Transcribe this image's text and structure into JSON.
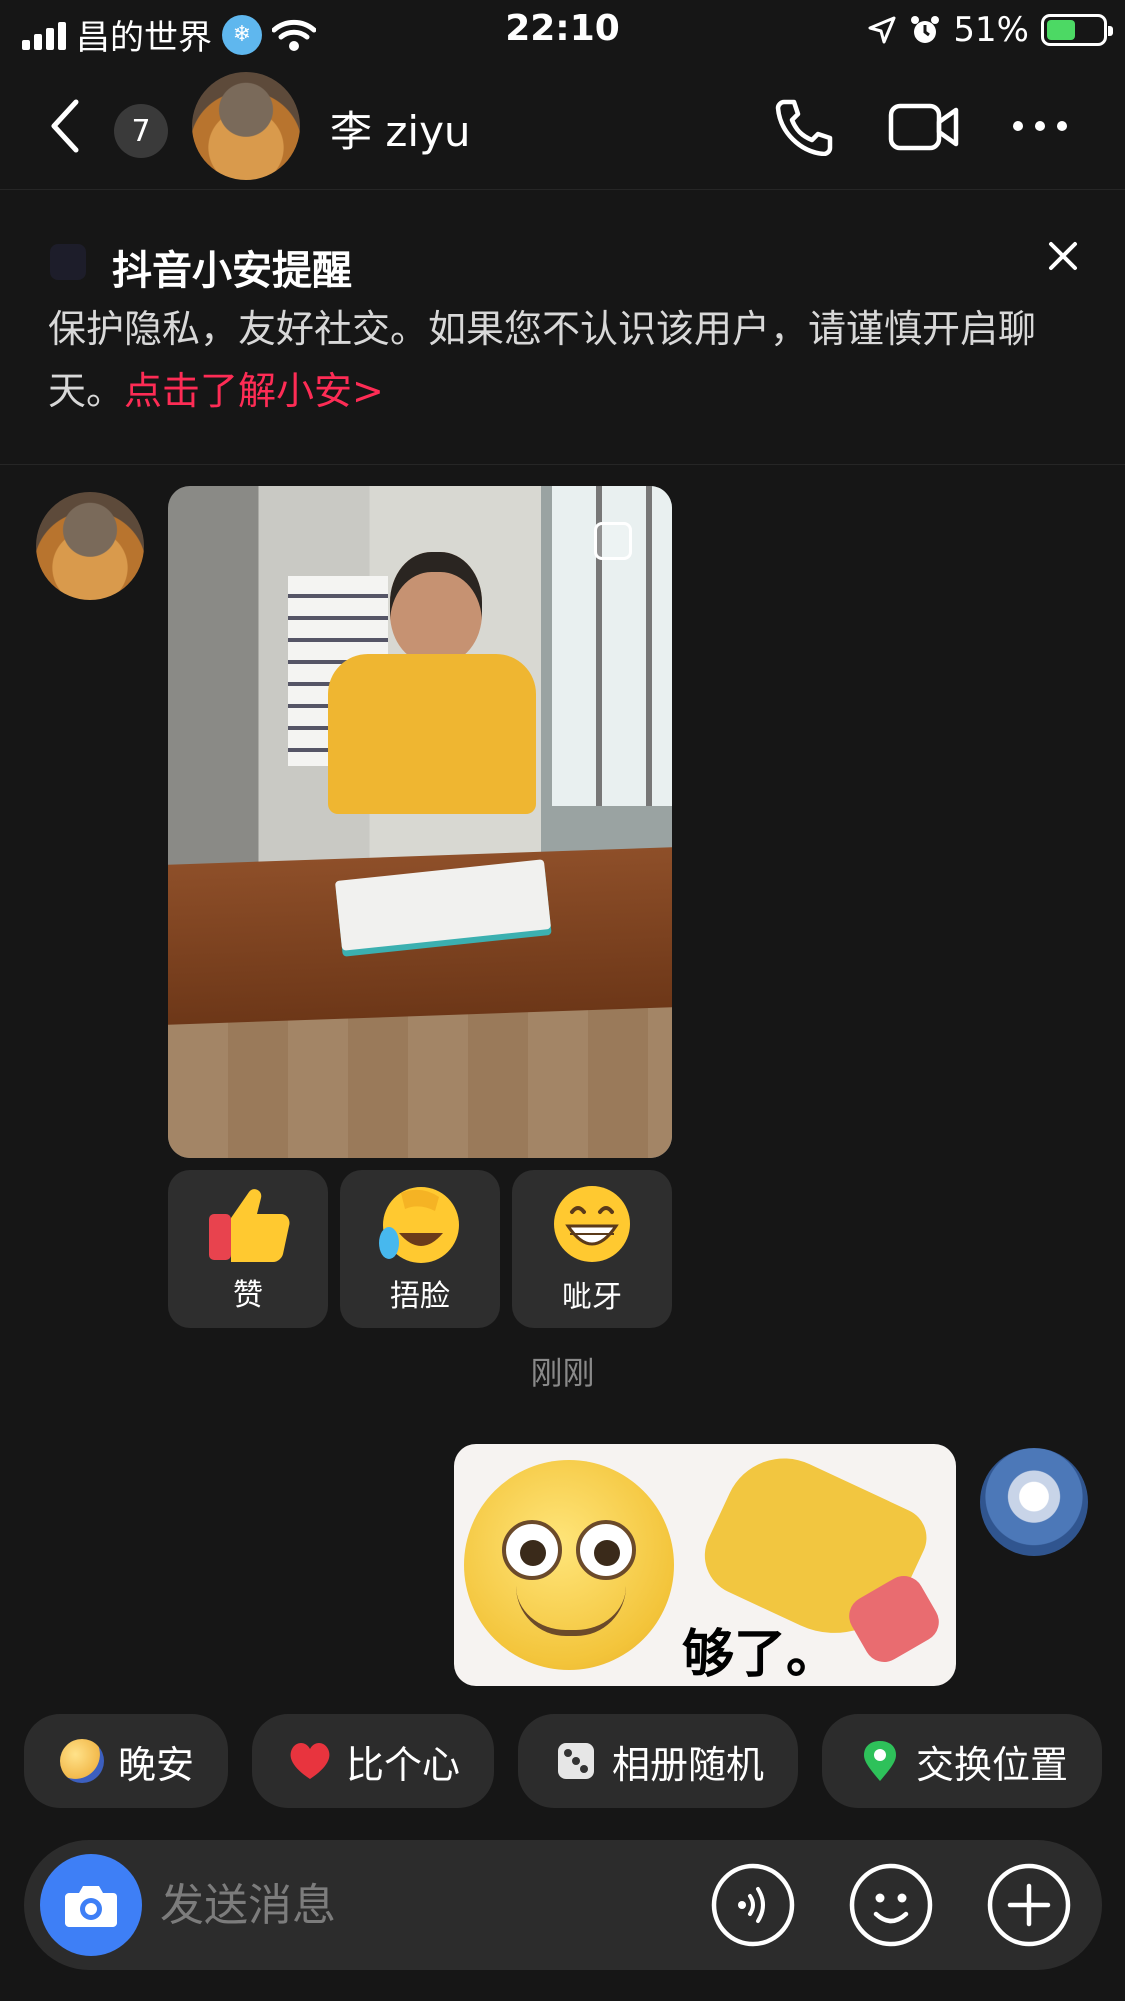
{
  "status_bar": {
    "carrier": "昌的世界",
    "time": "22:10",
    "battery_percent": "51%"
  },
  "header": {
    "unread_count": "7",
    "contact_name": "李 ziyu"
  },
  "reminder": {
    "title": "抖音小安提醒",
    "body": "保护隐私，友好社交。如果您不认识该用户，请谨慎开启聊天。",
    "link": "点击了解小安>"
  },
  "reactions": [
    {
      "icon": "thumbs-up-icon",
      "label": "赞"
    },
    {
      "icon": "facepalm-laugh-icon",
      "label": "捂脸"
    },
    {
      "icon": "grin-icon",
      "label": "呲牙"
    }
  ],
  "timestamp": "刚刚",
  "sticker_text": "够了。",
  "quick_replies": [
    {
      "icon": "moon-face-icon",
      "label": "晚安",
      "color": "#f2b94b"
    },
    {
      "icon": "heart-icon",
      "label": "比个心",
      "color": "#e8343e"
    },
    {
      "icon": "dice-icon",
      "label": "相册随机",
      "color": "#e6e6e6"
    },
    {
      "icon": "location-pin-icon",
      "label": "交换位置",
      "color": "#2ec15a"
    }
  ],
  "input": {
    "placeholder": "发送消息"
  },
  "colors": {
    "background": "#161616",
    "link_red": "#fe2c55",
    "camera_blue": "#3e7ff6"
  }
}
